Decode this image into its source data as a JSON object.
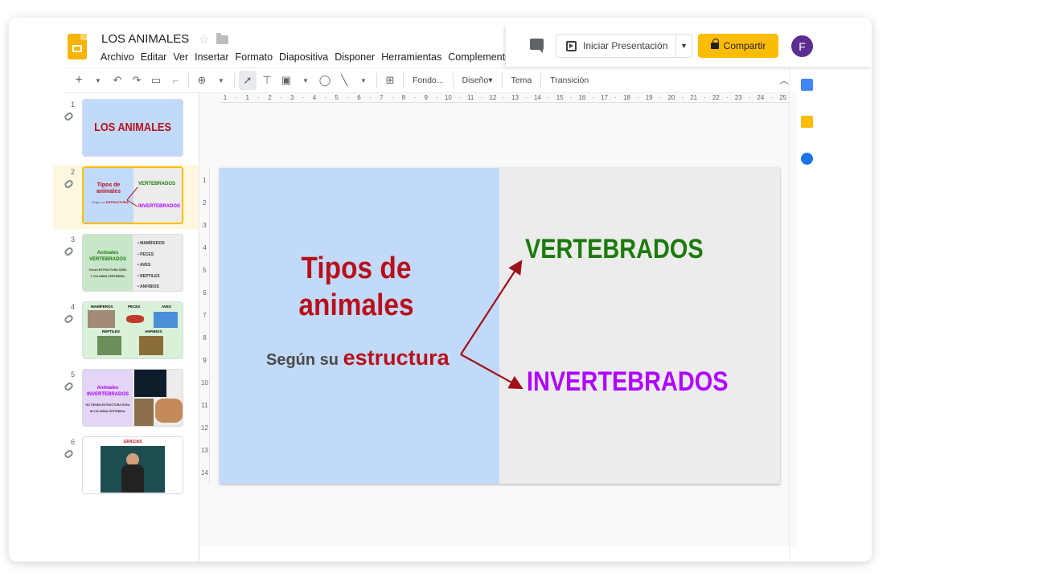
{
  "doc": {
    "title": "LOS ANIMALES"
  },
  "menu": [
    "Archivo",
    "Editar",
    "Ver",
    "Insertar",
    "Formato",
    "Diapositiva",
    "Disponer",
    "Herramientas",
    "Complementos"
  ],
  "header": {
    "present_label": "Iniciar Presentación",
    "share_label": "Compartir",
    "avatar_letter": "F"
  },
  "toolbar": {
    "background": "Fondo...",
    "layout": "Diseño",
    "theme": "Tema",
    "transition": "Transición"
  },
  "ruler_top": [
    "1",
    "",
    "1",
    "",
    "2",
    "",
    "3",
    "",
    "4",
    "",
    "5",
    "",
    "6",
    "",
    "7",
    "",
    "8",
    "",
    "9",
    "",
    "10",
    "",
    "11",
    "",
    "12",
    "",
    "13",
    "",
    "14",
    "",
    "15",
    "",
    "16",
    "",
    "17",
    "",
    "18",
    "",
    "19",
    "",
    "20",
    "",
    "21",
    "",
    "22",
    "",
    "23",
    "",
    "24",
    "",
    "25"
  ],
  "ruler_left": [
    "1",
    "2",
    "3",
    "4",
    "5",
    "6",
    "7",
    "8",
    "9",
    "10",
    "11",
    "12",
    "13",
    "14"
  ],
  "slides": [
    {
      "num": "1",
      "title": "LOS ANIMALES"
    },
    {
      "num": "2",
      "title": "Tipos de animales",
      "sub_a": "Según su",
      "sub_b": "ESTRUCTURA",
      "right_a": "VERTEBRADOS",
      "right_b": "INVERTEBRADOS"
    },
    {
      "num": "3",
      "title_a": "Animales",
      "title_b": "VERTEBRADOS",
      "note_a": "Tienen ESTRUCTURA ÓSEA",
      "note_b": "Y COLUMNA VERTEBRAL",
      "bullets": [
        "MAMÍFEROS",
        "PECES",
        "AVES",
        "REPTILES",
        "ANFIBIOS"
      ]
    },
    {
      "num": "4",
      "labels": [
        "MAMÍFEROS",
        "PECES",
        "AVES",
        "REPTILES",
        "ANFIBIOS"
      ]
    },
    {
      "num": "5",
      "title_a": "Animales",
      "title_b": "INVERTEBRADOS",
      "note_a": "NO TIENEN ESTRUCTURA ÓSEA",
      "note_b": "NI COLUMNA VERTEBRAL"
    },
    {
      "num": "6",
      "title": "GRACIAS"
    }
  ],
  "main_slide": {
    "title": "Tipos de animales",
    "subtitle_prefix": "Según su",
    "subtitle_emph": "estructura",
    "right_top": "VERTEBRADOS",
    "right_bottom": "INVERTEBRADOS"
  },
  "colors": {
    "accent_yellow": "#fbbc04",
    "title_red": "#b80f1a",
    "green": "#1b7a0a",
    "purple": "#b000ff",
    "left_pane": "#c2dafa"
  }
}
